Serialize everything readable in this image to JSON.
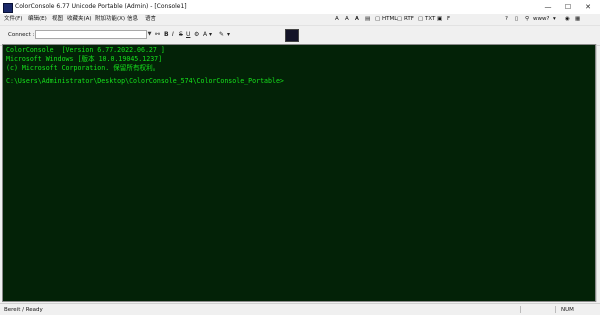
{
  "window": {
    "title": "ColorConsole 6.77 Unicode Portable (Admin) - [Console1]",
    "minimize": "—",
    "maximize": "☐",
    "close": "✕"
  },
  "menu": {
    "items": [
      "文件(F)",
      "编辑(E)",
      "视图",
      "收藏夹(A)",
      "附加功能(X)",
      "信息",
      "语言"
    ]
  },
  "right_tools": {
    "html_label": "HTML",
    "rtf_label": "RTF",
    "txt_label": "TXT",
    "theme_label": "www?"
  },
  "toolbar": {
    "connect_label": "Connect :",
    "connect_value": ""
  },
  "console": {
    "lines": [
      "ColorConsole  [Version 6.77.2022.06.27 ]",
      "Microsoft Windows [版本 10.0.19045.1237]",
      "(c) Microsoft Corporation. 保留所有权利。",
      "",
      "C:\\Users\\Administrator\\Desktop\\ColorConsole_574\\ColorConsole_Portable>"
    ]
  },
  "status": {
    "text": "Bereit / Ready",
    "numlock": "NUM"
  },
  "colors": {
    "console_bg": "#032207",
    "console_text": "#16e21c"
  }
}
